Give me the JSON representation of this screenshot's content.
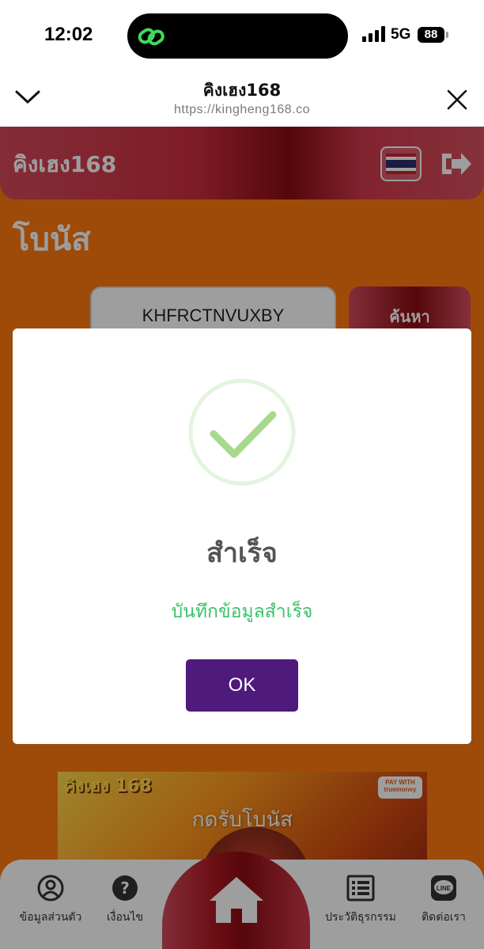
{
  "status_bar": {
    "time": "12:02",
    "network": "5G",
    "battery": "88"
  },
  "browser": {
    "title": "คิงเฮง168",
    "url": "https://kingheng168.co"
  },
  "site": {
    "name": "คิงเฮง168",
    "page_title": "โบนัส",
    "code_value": "KHFRCTNVUXBY",
    "search_label": "ค้นหา",
    "banner": {
      "logo": "คิงเฮง 168",
      "pay_badge": "PAY WITH truemoney",
      "text": "กดรับโบนัส"
    }
  },
  "bottom_nav": {
    "items": [
      {
        "label": "ข้อมูลส่วนตัว",
        "icon": "user-circle-icon"
      },
      {
        "label": "เงื่อนไข",
        "icon": "question-icon"
      },
      {
        "label": "",
        "icon": "home-icon"
      },
      {
        "label": "ประวัติธุรกรรม",
        "icon": "list-icon"
      },
      {
        "label": "ติดต่อเรา",
        "icon": "line-icon"
      }
    ]
  },
  "modal": {
    "title": "สำเร็จ",
    "message": "บันทึกข้อมูลสำเร็จ",
    "ok_label": "OK"
  },
  "colors": {
    "page_bg": "#ff7a10",
    "header_red": "#cc2e3e",
    "success_green": "#3cc16a",
    "ok_button": "#4e1a7c"
  }
}
